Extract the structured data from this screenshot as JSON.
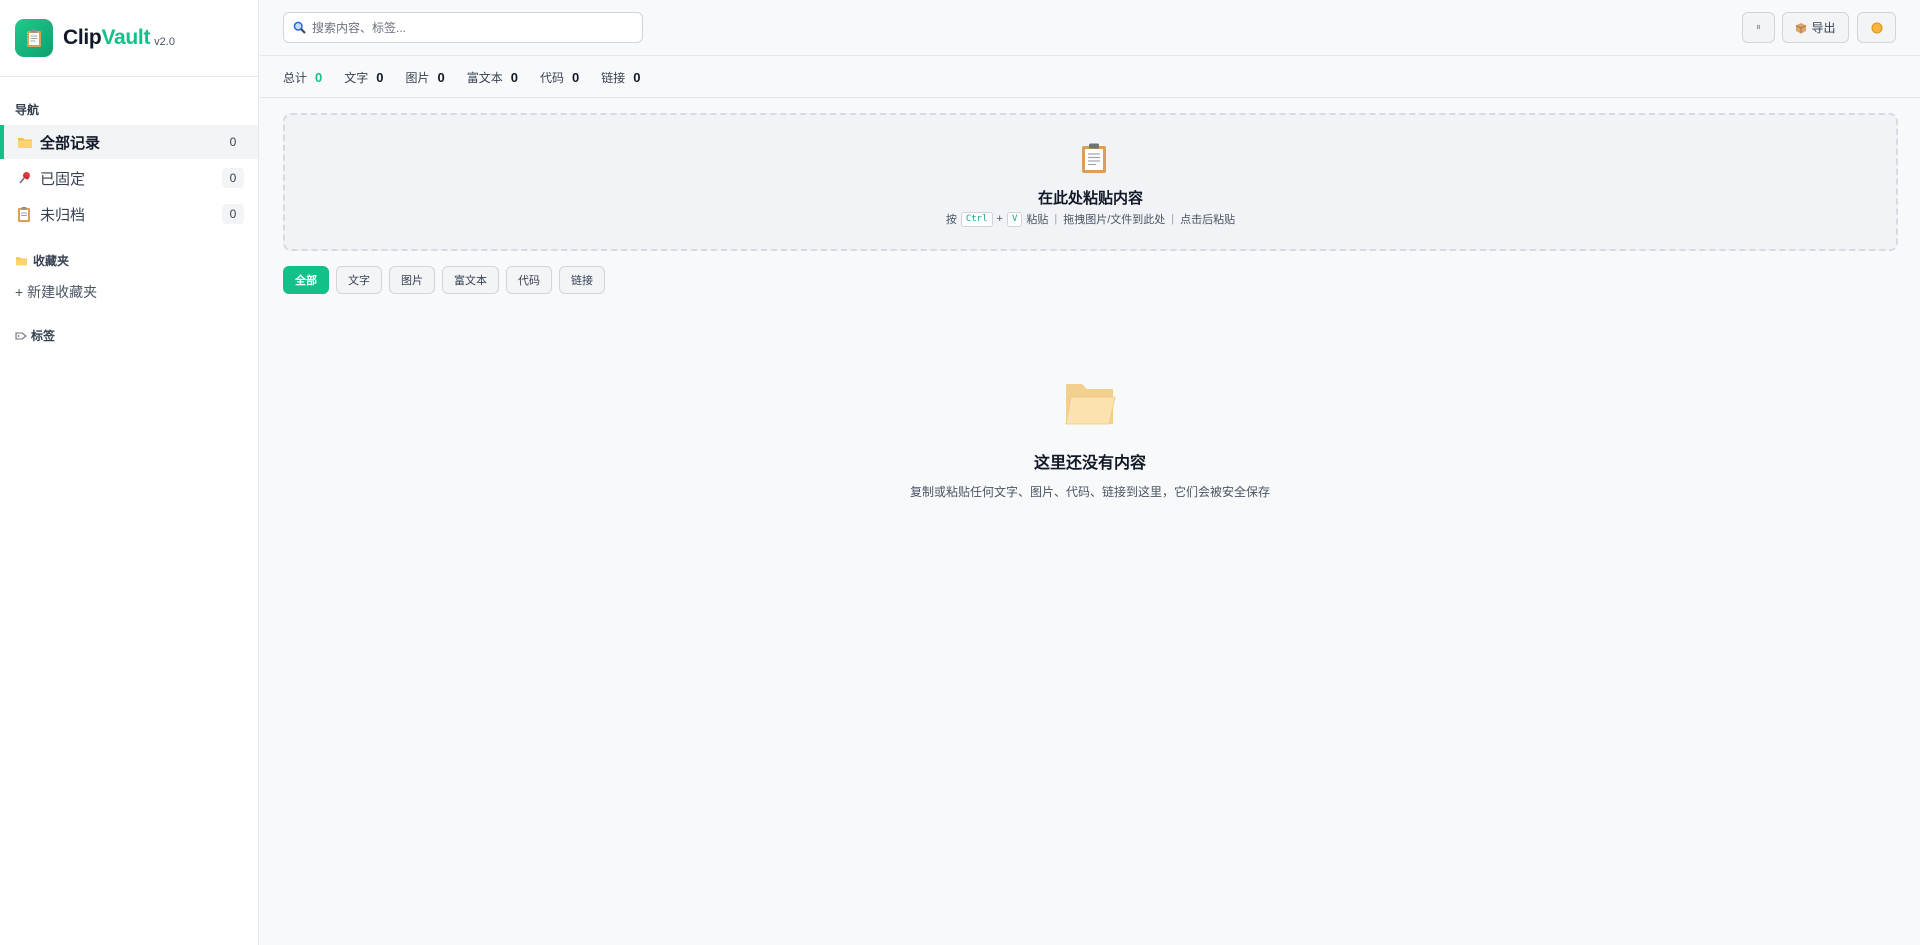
{
  "app": {
    "brand_part1": "Clip",
    "brand_part2": "Vault",
    "version": "v2.0",
    "accent_color": "#14c08a"
  },
  "sidebar": {
    "nav_heading": "导航",
    "items": [
      {
        "label": "全部记录",
        "count": "0",
        "icon": "folder-icon",
        "active": true
      },
      {
        "label": "已固定",
        "count": "0",
        "icon": "pin-icon",
        "active": false
      },
      {
        "label": "未归档",
        "count": "0",
        "icon": "clipboard-icon",
        "active": false
      }
    ],
    "favorites_heading": "收藏夹",
    "new_folder": "+ 新建收藏夹",
    "tags_heading": "标签"
  },
  "topbar": {
    "search_placeholder": "搜索内容、标签...",
    "pause_label": "⏸",
    "export_label": "导出",
    "theme_icon": "sun-icon"
  },
  "stats": [
    {
      "label": "总计",
      "value": "0"
    },
    {
      "label": "文字",
      "value": "0"
    },
    {
      "label": "图片",
      "value": "0"
    },
    {
      "label": "富文本",
      "value": "0"
    },
    {
      "label": "代码",
      "value": "0"
    },
    {
      "label": "链接",
      "value": "0"
    }
  ],
  "paste_zone": {
    "title": "在此处粘贴内容",
    "hint_press": "按",
    "key_ctrl": "Ctrl",
    "plus": "+",
    "key_v": "V",
    "hint_paste": "粘贴",
    "hint_drag": "拖拽图片/文件到此处",
    "hint_click": "点击后粘贴",
    "divider": "|"
  },
  "filters": [
    {
      "label": "全部",
      "active": true
    },
    {
      "label": "文字",
      "active": false
    },
    {
      "label": "图片",
      "active": false
    },
    {
      "label": "富文本",
      "active": false
    },
    {
      "label": "代码",
      "active": false
    },
    {
      "label": "链接",
      "active": false
    }
  ],
  "empty_state": {
    "title": "这里还没有内容",
    "description": "复制或粘贴任何文字、图片、代码、链接到这里，它们会被安全保存"
  }
}
